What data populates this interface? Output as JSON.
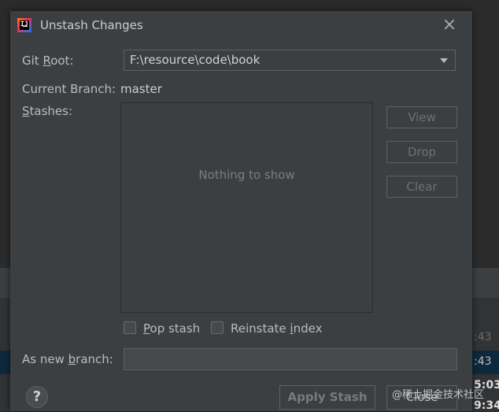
{
  "background": {
    "times": [
      ":43",
      ":43",
      "5:03",
      "9:34"
    ]
  },
  "dialog": {
    "title": "Unstash Changes",
    "close_icon": "close-icon",
    "git_root_label": "Git Root:",
    "git_root_value": "F:\\resource\\code\\book",
    "current_branch_label": "Current Branch:",
    "current_branch_value": "master",
    "stashes_label": "Stashes:",
    "stash_list_empty": "Nothing to show",
    "buttons": {
      "view": "View",
      "drop": "Drop",
      "clear": "Clear",
      "apply": "Apply Stash",
      "close": "Close"
    },
    "pop_stash_label": "Pop stash",
    "reinstate_index_label": "Reinstate index",
    "new_branch_label": "As new branch:",
    "new_branch_value": "",
    "help_label": "?"
  },
  "watermark": "@稀土掘金技术社区"
}
